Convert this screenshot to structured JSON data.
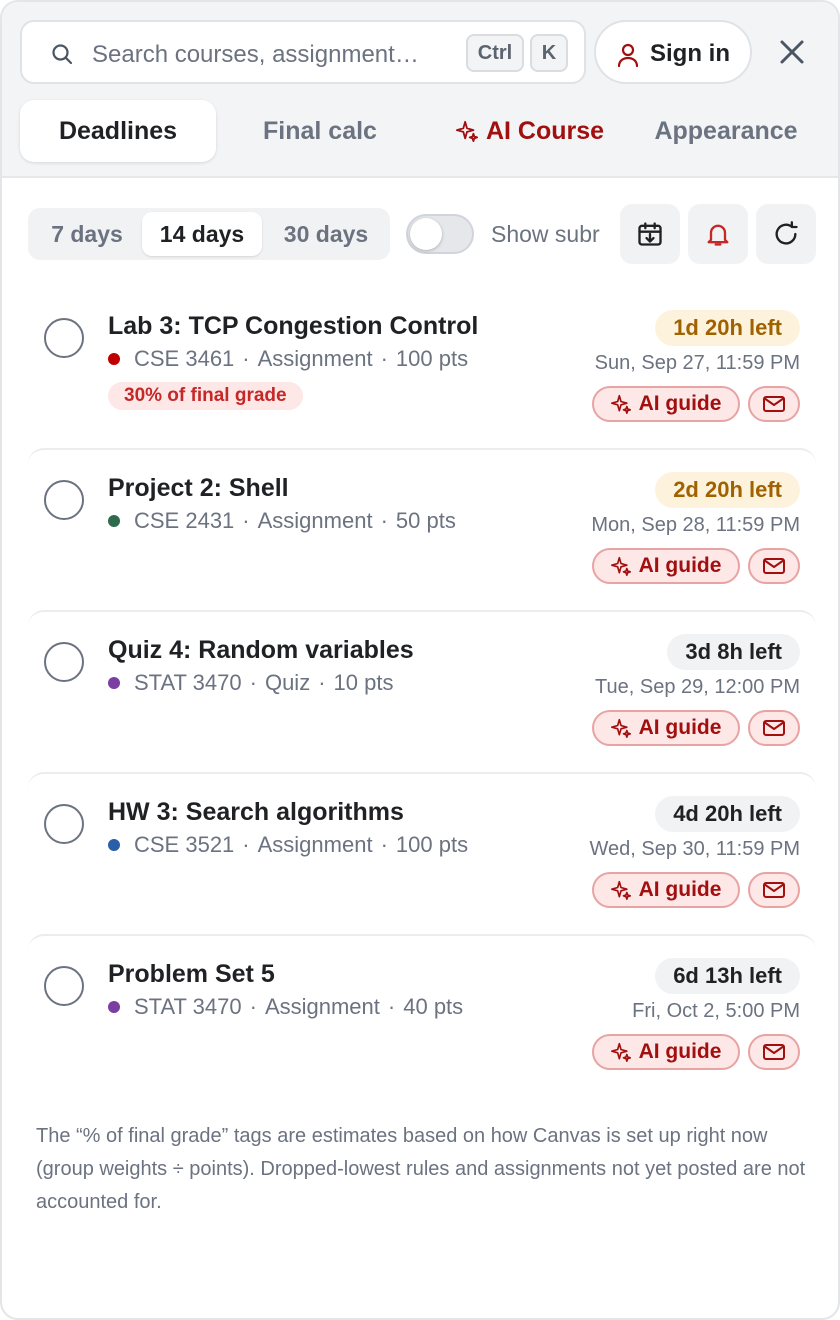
{
  "search": {
    "placeholder": "Search courses, assignment…",
    "shortcut_mod": "Ctrl",
    "shortcut_key": "K"
  },
  "header": {
    "sign_in_label": "Sign in"
  },
  "tabs": [
    {
      "label": "Deadlines",
      "active": true
    },
    {
      "label": "Final calc",
      "active": false
    },
    {
      "label": "AI Course",
      "active": false,
      "icon": "sparkle-icon"
    },
    {
      "label": "Appearance",
      "active": false
    }
  ],
  "range": {
    "options": [
      "7 days",
      "14 days",
      "30 days"
    ],
    "selected": "14 days"
  },
  "toggle": {
    "label": "Show subr",
    "on": false
  },
  "actions": {
    "icons": [
      "calendar-download-icon",
      "bell-icon",
      "refresh-icon"
    ]
  },
  "colors": {
    "accent": "#a10f0f",
    "warning_badge": "#a06200",
    "CSE 3461": "#c00000",
    "CSE 2431": "#2e6b4e",
    "STAT 3470": "#7a3fa0",
    "CSE 3521": "#2a5ea8"
  },
  "items": [
    {
      "title": "Lab 3: TCP Congestion Control",
      "course": "CSE 3461",
      "type": "Assignment",
      "points": "100 pts",
      "grade_tag": "30% of final grade",
      "time_left": "1d 20h left",
      "due": "Sun, Sep 27, 11:59 PM",
      "ai_guide_label": "AI guide"
    },
    {
      "title": "Project 2: Shell",
      "course": "CSE 2431",
      "type": "Assignment",
      "points": "50 pts",
      "time_left": "2d 20h left",
      "due": "Mon, Sep 28, 11:59 PM",
      "ai_guide_label": "AI guide"
    },
    {
      "title": "Quiz 4: Random variables",
      "course": "STAT 3470",
      "type": "Quiz",
      "points": "10 pts",
      "time_left": "3d 8h left",
      "due": "Tue, Sep 29, 12:00 PM",
      "ai_guide_label": "AI guide"
    },
    {
      "title": "HW 3: Search algorithms",
      "course": "CSE 3521",
      "type": "Assignment",
      "points": "100 pts",
      "time_left": "4d 20h left",
      "due": "Wed, Sep 30, 11:59 PM",
      "ai_guide_label": "AI guide"
    },
    {
      "title": "Problem Set 5",
      "course": "STAT 3470",
      "type": "Assignment",
      "points": "40 pts",
      "time_left": "6d 13h left",
      "due": "Fri, Oct 2, 5:00 PM",
      "ai_guide_label": "AI guide"
    }
  ],
  "footer_note": "The “% of final grade” tags are estimates based on how Canvas is set up right now (group weights ÷ points). Dropped-lowest rules and assignments not yet posted are not accounted for."
}
